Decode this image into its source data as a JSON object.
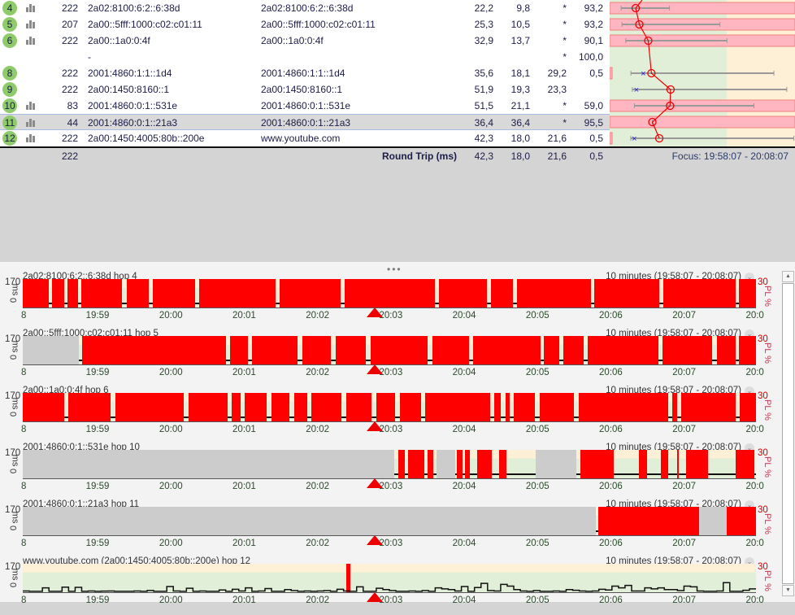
{
  "table": {
    "graph_scale": {
      "max_ms": 158,
      "green_until_ms": 100
    },
    "rows": [
      {
        "hop": "4",
        "bars": true,
        "count": "222",
        "ip": "2a02:8100:6:2::6:38d",
        "name": "2a02:8100:6:2::6:38d",
        "avg": "22,2",
        "min": "9,8",
        "cur": "*",
        "pl": "93,2",
        "avg_ms": 22.2,
        "min_ms": 9.8,
        "max_ms": 51,
        "pl_bar": true,
        "show_min_x": false
      },
      {
        "hop": "5",
        "bars": true,
        "count": "207",
        "ip": "2a00::5fff:1000:c02:c01:11",
        "name": "2a00::5fff:1000:c02:c01:11",
        "avg": "25,3",
        "min": "10,5",
        "cur": "*",
        "pl": "93,2",
        "avg_ms": 25.3,
        "min_ms": 10.5,
        "max_ms": 94,
        "pl_bar": true,
        "show_min_x": false
      },
      {
        "hop": "6",
        "bars": true,
        "count": "222",
        "ip": "2a00::1a0:0:4f",
        "name": "2a00::1a0:0:4f",
        "avg": "32,9",
        "min": "13,7",
        "cur": "*",
        "pl": "90,1",
        "avg_ms": 32.9,
        "min_ms": 13.7,
        "max_ms": 100,
        "pl_bar": true,
        "show_min_x": false
      },
      {
        "hop": "",
        "bars": false,
        "count": "",
        "ip": "-",
        "name": "",
        "avg": "",
        "min": "",
        "cur": "*",
        "pl": "100,0"
      },
      {
        "hop": "8",
        "bars": false,
        "count": "222",
        "ip": "2001:4860:1:1::1d4",
        "name": "2001:4860:1:1::1d4",
        "avg": "35,6",
        "min": "18,1",
        "cur": "29,2",
        "pl": "0,5",
        "avg_ms": 35.6,
        "min_ms": 18.1,
        "max_ms": 140,
        "cur_ms": 29.2,
        "pl_bar": "small"
      },
      {
        "hop": "9",
        "bars": false,
        "count": "222",
        "ip": "2a00:1450:8160::1",
        "name": "2a00:1450:8160::1",
        "avg": "51,9",
        "min": "19,3",
        "cur": "23,3",
        "pl": "",
        "avg_ms": 51.9,
        "min_ms": 19.3,
        "max_ms": 151,
        "cur_ms": 23.3,
        "pl_bar": false
      },
      {
        "hop": "10",
        "bars": true,
        "count": "83",
        "ip": "2001:4860:0:1::531e",
        "name": "2001:4860:0:1::531e",
        "avg": "51,5",
        "min": "21,1",
        "cur": "*",
        "pl": "59,0",
        "avg_ms": 51.5,
        "min_ms": 21.1,
        "max_ms": 123,
        "pl_bar": true
      },
      {
        "hop": "11",
        "bars": true,
        "count": "44",
        "ip": "2001:4860:0:1::21a3",
        "name": "2001:4860:0:1::21a3",
        "avg": "36,4",
        "min": "36,4",
        "cur": "*",
        "pl": "95,5",
        "avg_ms": 36.4,
        "min_ms": 36.4,
        "max_ms": 36.4,
        "pl_bar": true,
        "selected": true
      },
      {
        "hop": "12",
        "bars": true,
        "count": "222",
        "ip": "2a00:1450:4005:80b::200e",
        "name": "www.youtube.com",
        "avg": "42,3",
        "min": "18,0",
        "cur": "21,6",
        "pl": "0,5",
        "avg_ms": 42.3,
        "min_ms": 18.0,
        "max_ms": 157,
        "cur_ms": 21.6,
        "pl_bar": "small"
      }
    ],
    "summary": {
      "count": "222",
      "label": "Round Trip (ms)",
      "avg": "42,3",
      "min": "18,0",
      "cur": "21,6",
      "pl": "0,5",
      "focus": "Focus: 19:58:07 - 20:08:07"
    }
  },
  "colors": {
    "loss": "#ff0000",
    "nodata": "#cccccc",
    "hop_badge": "#8fcb6b",
    "pl_bar": "#ffb6c1",
    "good": "#e2efd8",
    "warn": "#fdf0d6"
  },
  "charts_common": {
    "range": "10 minutes (19:58:07 - 20:08:07)",
    "y_top": "170",
    "y_bottom": "0",
    "y_unit": "ms",
    "pl_top": "30",
    "pl_unit": "PL %",
    "ticks": [
      {
        "label": "8",
        "min": 0
      },
      {
        "label": "19:59",
        "min": 0.883
      },
      {
        "label": "20:00",
        "min": 1.883
      },
      {
        "label": "20:01",
        "min": 2.883
      },
      {
        "label": "20:02",
        "min": 3.883
      },
      {
        "label": "20:03",
        "min": 4.883
      },
      {
        "label": "20:04",
        "min": 5.883
      },
      {
        "label": "20:05",
        "min": 6.883
      },
      {
        "label": "20:06",
        "min": 7.883
      },
      {
        "label": "20:07",
        "min": 8.883
      },
      {
        "label": "20:0",
        "min": 9.883
      }
    ],
    "focus_marker_min": 4.8
  },
  "chart_data": [
    {
      "type": "timeline",
      "title": "2a02:8100:6:2::6:38d hop 4",
      "gray": [],
      "loss": [
        [
          0,
          0.35
        ],
        [
          0.4,
          0.57
        ],
        [
          0.61,
          0.75
        ],
        [
          0.8,
          1.35
        ],
        [
          1.42,
          1.72
        ],
        [
          1.77,
          2.35
        ],
        [
          2.41,
          3.45
        ],
        [
          3.5,
          4.33
        ],
        [
          4.39,
          5.62
        ],
        [
          5.68,
          6.33
        ],
        [
          6.39,
          6.69
        ],
        [
          6.74,
          7.75
        ],
        [
          7.79,
          8.68
        ],
        [
          8.74,
          9.72
        ],
        [
          9.77,
          10
        ]
      ]
    },
    {
      "type": "timeline",
      "title": "2a00::5fff:1000:c02:c01:11 hop 5",
      "gray": [
        [
          0,
          0.77
        ]
      ],
      "loss": [
        [
          0.81,
          2.77
        ],
        [
          2.83,
          3.07
        ],
        [
          3.13,
          3.75
        ],
        [
          3.81,
          4.2
        ],
        [
          4.27,
          4.68
        ],
        [
          4.74,
          5.52
        ],
        [
          5.59,
          6.09
        ],
        [
          6.14,
          7.06
        ],
        [
          7.11,
          7.32
        ],
        [
          7.37,
          7.65
        ],
        [
          7.7,
          8.67
        ],
        [
          8.72,
          9.4
        ],
        [
          9.47,
          9.72
        ],
        [
          9.77,
          10
        ]
      ]
    },
    {
      "type": "timeline",
      "title": "2a00::1a0:0:4f hop 6",
      "gray": [],
      "loss": [
        [
          0,
          0.56
        ],
        [
          0.62,
          1.2
        ],
        [
          1.26,
          2.2
        ],
        [
          2.26,
          2.79
        ],
        [
          2.85,
          2.97
        ],
        [
          3.03,
          3.33
        ],
        [
          3.39,
          3.64
        ],
        [
          3.7,
          3.88
        ],
        [
          3.94,
          4.35
        ],
        [
          4.41,
          4.76
        ],
        [
          4.82,
          5.08
        ],
        [
          5.14,
          5.43
        ],
        [
          5.49,
          6.37
        ],
        [
          6.43,
          6.52
        ],
        [
          6.58,
          6.64
        ],
        [
          6.7,
          6.99
        ],
        [
          7.05,
          7.52
        ],
        [
          7.58,
          8.8
        ],
        [
          8.86,
          8.92
        ],
        [
          8.98,
          9.72
        ],
        [
          9.78,
          10
        ]
      ]
    },
    {
      "type": "timeline",
      "title": "2001:4860:0:1::531e hop 10",
      "gray": [
        [
          0,
          5.07
        ],
        [
          5.64,
          5.9
        ],
        [
          7.0,
          7.55
        ]
      ],
      "loss": [
        [
          5.12,
          5.21
        ],
        [
          5.25,
          5.48
        ],
        [
          5.52,
          5.6
        ],
        [
          5.92,
          6.0
        ],
        [
          6.03,
          6.1
        ],
        [
          6.2,
          6.4
        ],
        [
          6.5,
          6.6
        ],
        [
          7.6,
          8.06
        ],
        [
          8.4,
          8.52
        ],
        [
          8.7,
          8.8
        ],
        [
          8.92,
          8.95
        ],
        [
          9.05,
          9.35
        ],
        [
          9.72,
          9.98
        ]
      ]
    },
    {
      "type": "timeline",
      "title": "2001:4860:0:1::21a3 hop 11",
      "gray": [
        [
          0,
          7.82
        ],
        [
          9.22,
          9.6
        ]
      ],
      "loss": [
        [
          7.85,
          9.22
        ],
        [
          9.6,
          10
        ]
      ]
    },
    {
      "type": "line",
      "title": "www.youtube.com (2a00:1450:4005:80b::200e) hop 12",
      "ylim": [
        0,
        170
      ],
      "loss": [
        [
          4.41,
          4.47
        ]
      ],
      "values": [
        12,
        10,
        10,
        30,
        10,
        10,
        34,
        10,
        33,
        10,
        12,
        10,
        11,
        12,
        10,
        10,
        10,
        12,
        10,
        15,
        10,
        10,
        38,
        12,
        10,
        28,
        10,
        12,
        10,
        10,
        18,
        10,
        22,
        12,
        30,
        10,
        12,
        26,
        10,
        10,
        20,
        14,
        10,
        12,
        10,
        12,
        14,
        10,
        22,
        12,
        10,
        36,
        10,
        10,
        28,
        20,
        14,
        10,
        10,
        12,
        10,
        14,
        10,
        30,
        24,
        20,
        12,
        38,
        10,
        32,
        56,
        14,
        12,
        50,
        40,
        20,
        12,
        10,
        14,
        10,
        10,
        12,
        10,
        20,
        16,
        12,
        10,
        12,
        22,
        18,
        40,
        30,
        44,
        12,
        12,
        30,
        24,
        30,
        20,
        20,
        14,
        40,
        36,
        12,
        10,
        10,
        12,
        60,
        10,
        10,
        16,
        24
      ]
    }
  ]
}
